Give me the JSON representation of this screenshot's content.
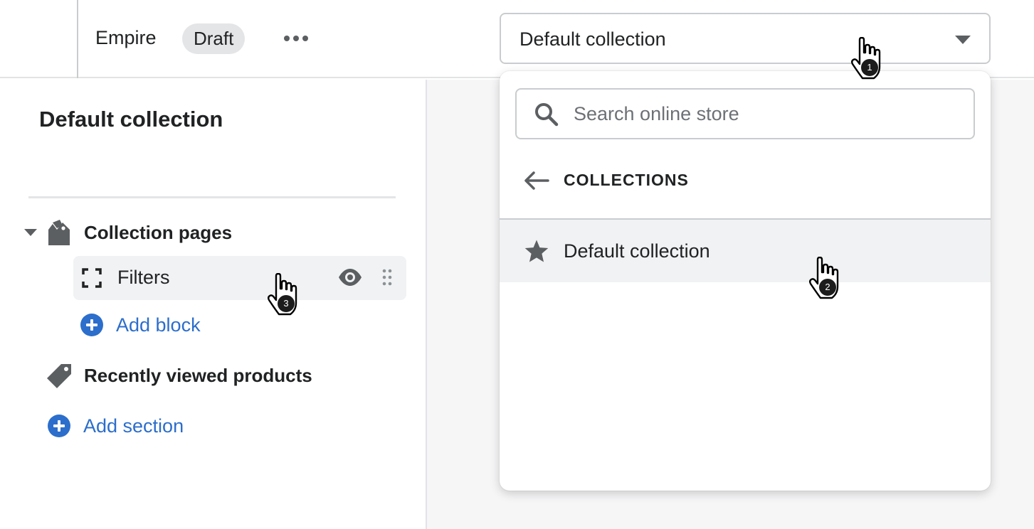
{
  "topbar": {
    "theme_name": "Empire",
    "status_badge": "Draft",
    "more_icon": "horizontal-dots-icon",
    "selector": {
      "value": "Default collection",
      "caret_icon": "caret-down-icon"
    }
  },
  "sidebar": {
    "title": "Default collection",
    "sections": [
      {
        "label": "Collection pages",
        "icon": "collection-tags-icon",
        "expanded": true,
        "blocks": [
          {
            "label": "Filters",
            "icon": "frame-icon",
            "actions": [
              "eye-icon",
              "drag-handle-icon"
            ]
          }
        ],
        "add_block_label": "Add block"
      },
      {
        "label": "Recently viewed products",
        "icon": "tag-icon"
      }
    ],
    "add_section_label": "Add section"
  },
  "dropdown": {
    "search_placeholder": "Search online store",
    "back_label": "COLLECTIONS",
    "items": [
      {
        "label": "Default collection",
        "icon": "star-icon",
        "highlighted": true
      }
    ]
  },
  "cursors": [
    {
      "number": "1",
      "target": "collection-selector"
    },
    {
      "number": "2",
      "target": "dropdown-item-default-collection"
    },
    {
      "number": "3",
      "target": "block-filters"
    }
  ],
  "colors": {
    "accent": "#2c6ecb",
    "text": "#202223",
    "icon": "#5c5f62",
    "highlight": "#f1f2f3",
    "preview_bg": "#f6f6f7"
  }
}
